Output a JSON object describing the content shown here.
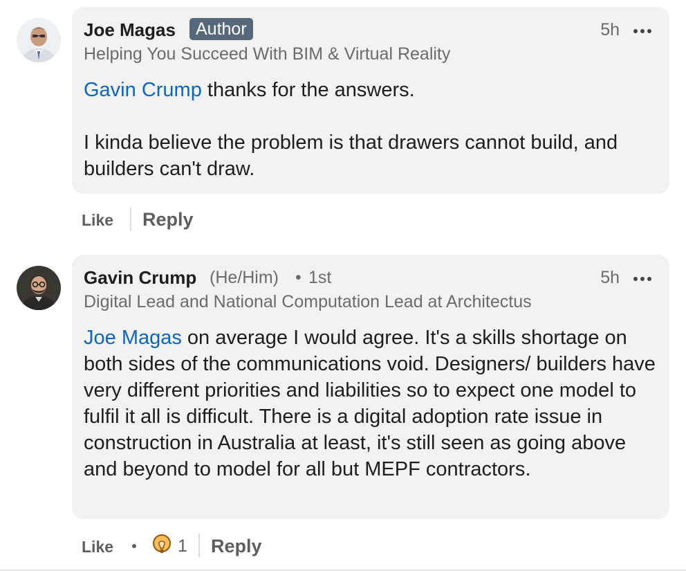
{
  "comments": [
    {
      "author": "Joe Magas",
      "badge": "Author",
      "headline": "Helping You Succeed With BIM & Virtual Reality",
      "time": "5h",
      "mention": "Gavin Crump",
      "text_after_mention": " thanks for the answers.",
      "paragraph2": "I kinda believe the problem is that drawers cannot build, and builders can't draw.",
      "actions": {
        "like": "Like",
        "reply": "Reply"
      }
    },
    {
      "author": "Gavin Crump",
      "pronouns": "(He/Him)",
      "separator": "•",
      "degree": "1st",
      "headline": "Digital Lead and National Computation Lead at Architectus",
      "time": "5h",
      "mention": "Joe Magas",
      "text_after_mention": " on average I would agree. It's a skills shortage on both sides of the communications void. Designers/ builders have very different priorities and liabilities so to expect one model to fulfil it all is difficult. There is a digital adoption rate issue in construction in Australia at least, it's still seen as going above and beyond to model for all but MEPF contractors.",
      "reaction_icon": "insightful-lightbulb-icon",
      "reaction_count": "1",
      "actions": {
        "like": "Like",
        "reply": "Reply"
      }
    }
  ],
  "colors": {
    "bubble": "#f2f2f2",
    "mention": "#0a66c2",
    "badge": "#56687a",
    "muted": "#6b6b6b"
  }
}
